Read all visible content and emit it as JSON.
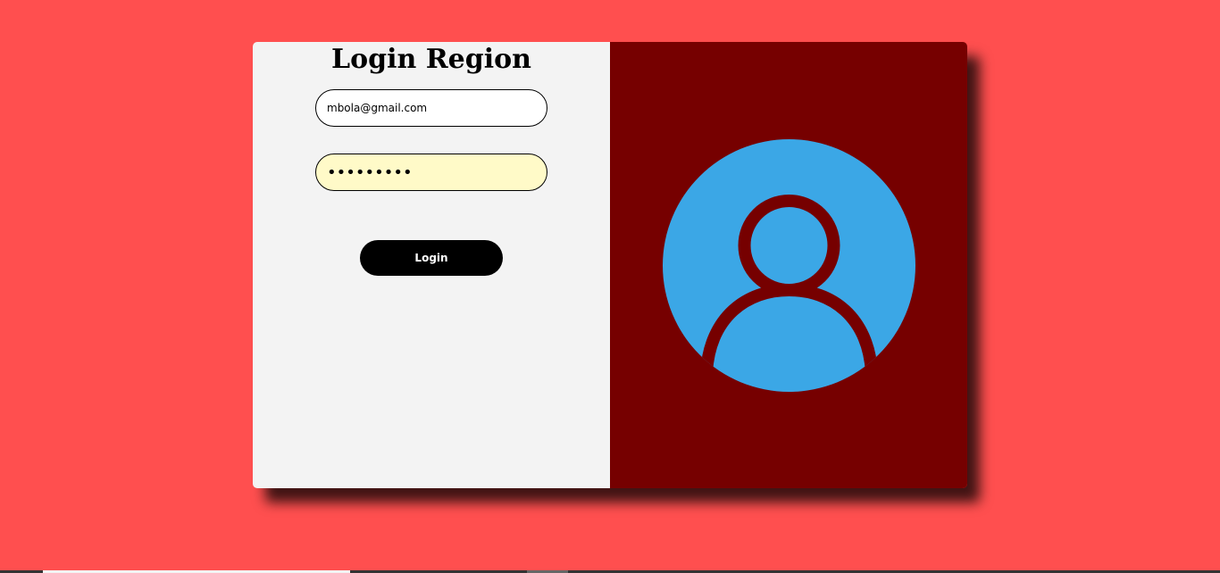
{
  "login": {
    "title": "Login Region",
    "email_value": "mbola@gmail.com",
    "password_value": "password1",
    "button_label": "Login"
  },
  "avatar": {
    "icon": "user-profile-icon",
    "circle_color": "#3ba7e6",
    "outline_color": "#760000"
  },
  "colors": {
    "page_background": "#ff4f4f",
    "form_panel": "#f3f3f3",
    "image_panel": "#760000",
    "button": "#000000",
    "password_field": "#fffac8"
  }
}
